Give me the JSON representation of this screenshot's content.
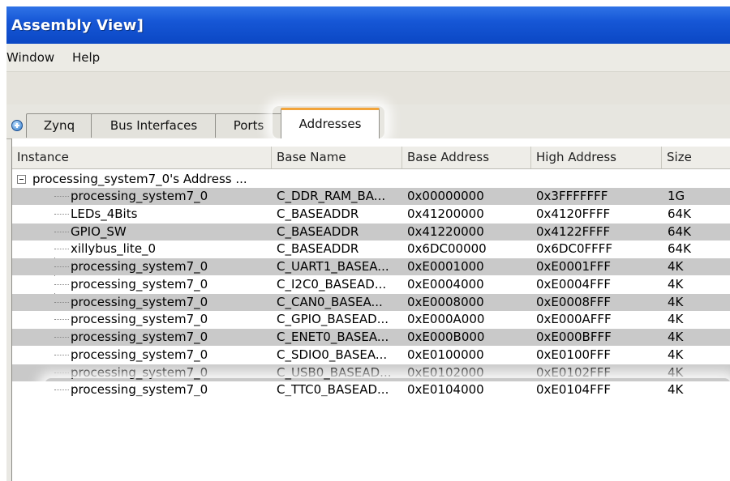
{
  "window": {
    "title": "Assembly View]"
  },
  "menu": {
    "items": [
      "Window",
      "Help"
    ]
  },
  "tabs": [
    {
      "label": "Zynq",
      "active": false
    },
    {
      "label": "Bus Interfaces",
      "active": false
    },
    {
      "label": "Ports",
      "active": false
    },
    {
      "label": "Addresses",
      "active": true
    }
  ],
  "table": {
    "columns": [
      "Instance",
      "Base Name",
      "Base Address",
      "High Address",
      "Size"
    ],
    "group": "processing_system7_0's Address ...",
    "rows": [
      {
        "instance": "processing_system7_0",
        "base_name": "C_DDR_RAM_BA...",
        "base_address": "0x00000000",
        "high_address": "0x3FFFFFFF",
        "size": "1G"
      },
      {
        "instance": "LEDs_4Bits",
        "base_name": "C_BASEADDR",
        "base_address": "0x41200000",
        "high_address": "0x4120FFFF",
        "size": "64K"
      },
      {
        "instance": "GPIO_SW",
        "base_name": "C_BASEADDR",
        "base_address": "0x41220000",
        "high_address": "0x4122FFFF",
        "size": "64K"
      },
      {
        "instance": "xillybus_lite_0",
        "base_name": "C_BASEADDR",
        "base_address": "0x6DC00000",
        "high_address": "0x6DC0FFFF",
        "size": "64K"
      },
      {
        "instance": "processing_system7_0",
        "base_name": "C_UART1_BASEA...",
        "base_address": "0xE0001000",
        "high_address": "0xE0001FFF",
        "size": "4K"
      },
      {
        "instance": "processing_system7_0",
        "base_name": "C_I2C0_BASEAD...",
        "base_address": "0xE0004000",
        "high_address": "0xE0004FFF",
        "size": "4K"
      },
      {
        "instance": "processing_system7_0",
        "base_name": "C_CAN0_BASEA...",
        "base_address": "0xE0008000",
        "high_address": "0xE0008FFF",
        "size": "4K"
      },
      {
        "instance": "processing_system7_0",
        "base_name": "C_GPIO_BASEAD...",
        "base_address": "0xE000A000",
        "high_address": "0xE000AFFF",
        "size": "4K"
      },
      {
        "instance": "processing_system7_0",
        "base_name": "C_ENET0_BASEA...",
        "base_address": "0xE000B000",
        "high_address": "0xE000BFFF",
        "size": "4K"
      },
      {
        "instance": "processing_system7_0",
        "base_name": "C_SDIO0_BASEA...",
        "base_address": "0xE0100000",
        "high_address": "0xE0100FFF",
        "size": "4K"
      },
      {
        "instance": "processing_system7_0",
        "base_name": "C_USB0_BASEAD...",
        "base_address": "0xE0102000",
        "high_address": "0xE0102FFF",
        "size": "4K"
      },
      {
        "instance": "processing_system7_0",
        "base_name": "C_TTC0_BASEAD...",
        "base_address": "0xE0104000",
        "high_address": "0xE0104FFF",
        "size": "4K"
      }
    ]
  },
  "colors": {
    "titlebar": "#1657d6",
    "active_tab_accent": "#f2a43a",
    "alt_row": "#c9c9c9"
  }
}
